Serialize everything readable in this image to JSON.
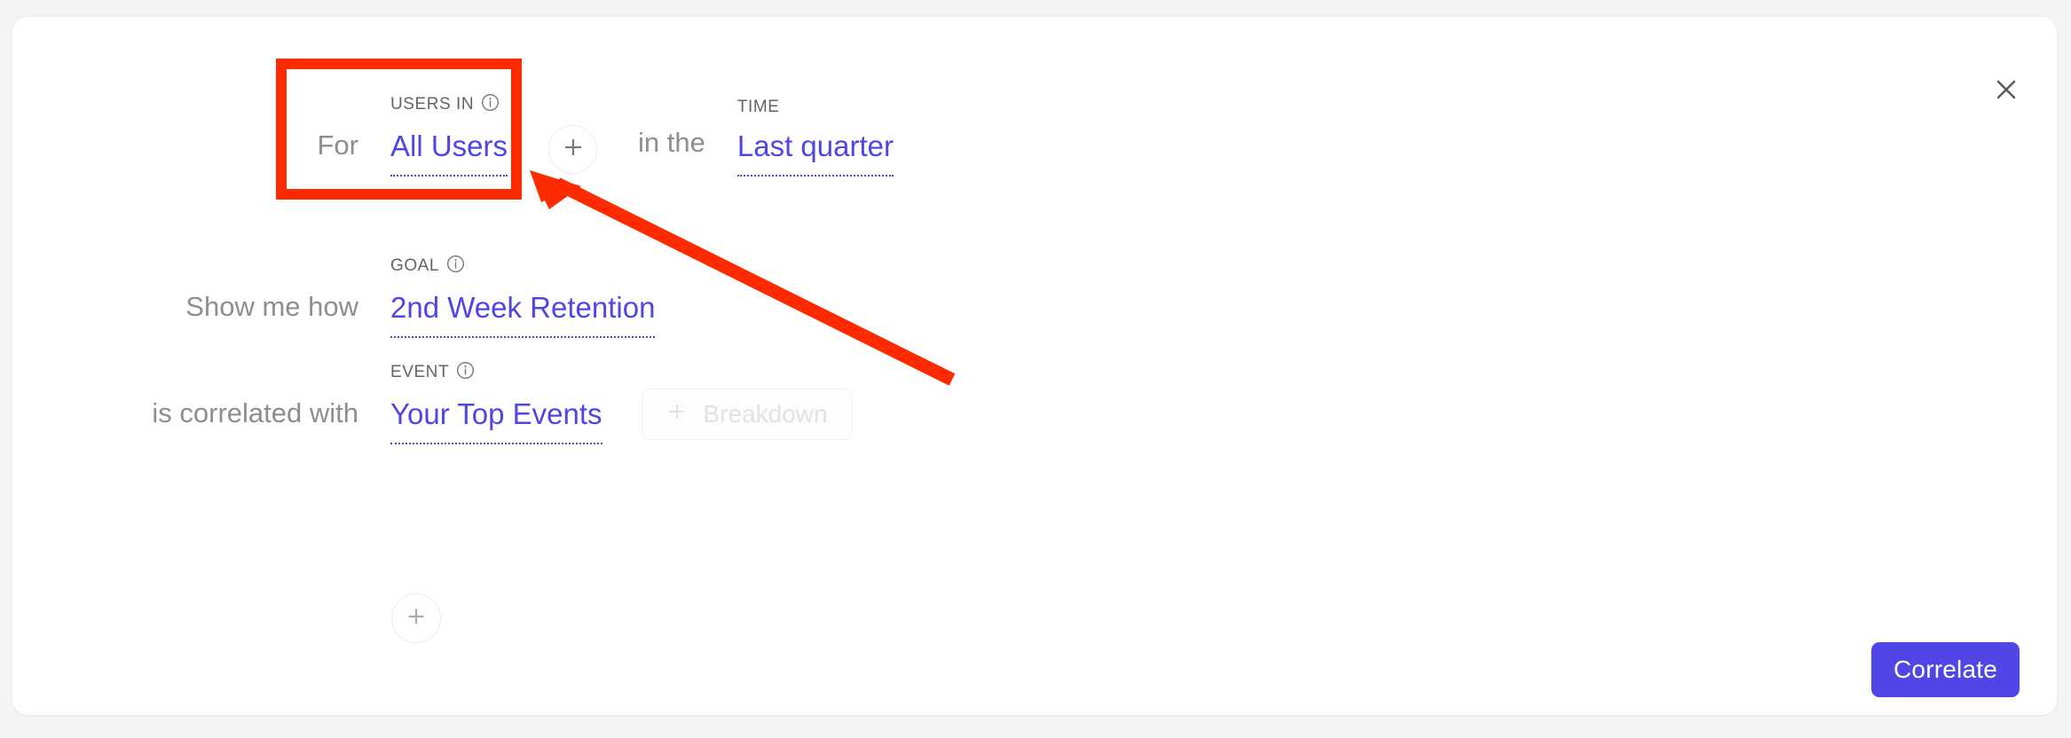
{
  "dialog": {
    "close_icon": "close-icon",
    "accent_color": "#4f46e5",
    "annotation_color": "#ff2b00"
  },
  "query": {
    "rows": [
      {
        "lead": "For",
        "label": "USERS IN",
        "label_info_icon": "info-icon",
        "value": "All Users",
        "add_icon": "plus-icon",
        "connector": "in the",
        "second_label": "TIME",
        "second_value": "Last quarter"
      },
      {
        "lead": "Show me how",
        "label": "GOAL",
        "label_info_icon": "info-icon",
        "value": "2nd Week Retention"
      },
      {
        "lead": "is correlated with",
        "label": "EVENT",
        "label_info_icon": "info-icon",
        "value": "Your Top Events",
        "breakdown_label": "Breakdown",
        "breakdown_icon": "plus-icon"
      }
    ],
    "add_row_icon": "plus-icon"
  },
  "footer": {
    "submit_label": "Correlate"
  }
}
